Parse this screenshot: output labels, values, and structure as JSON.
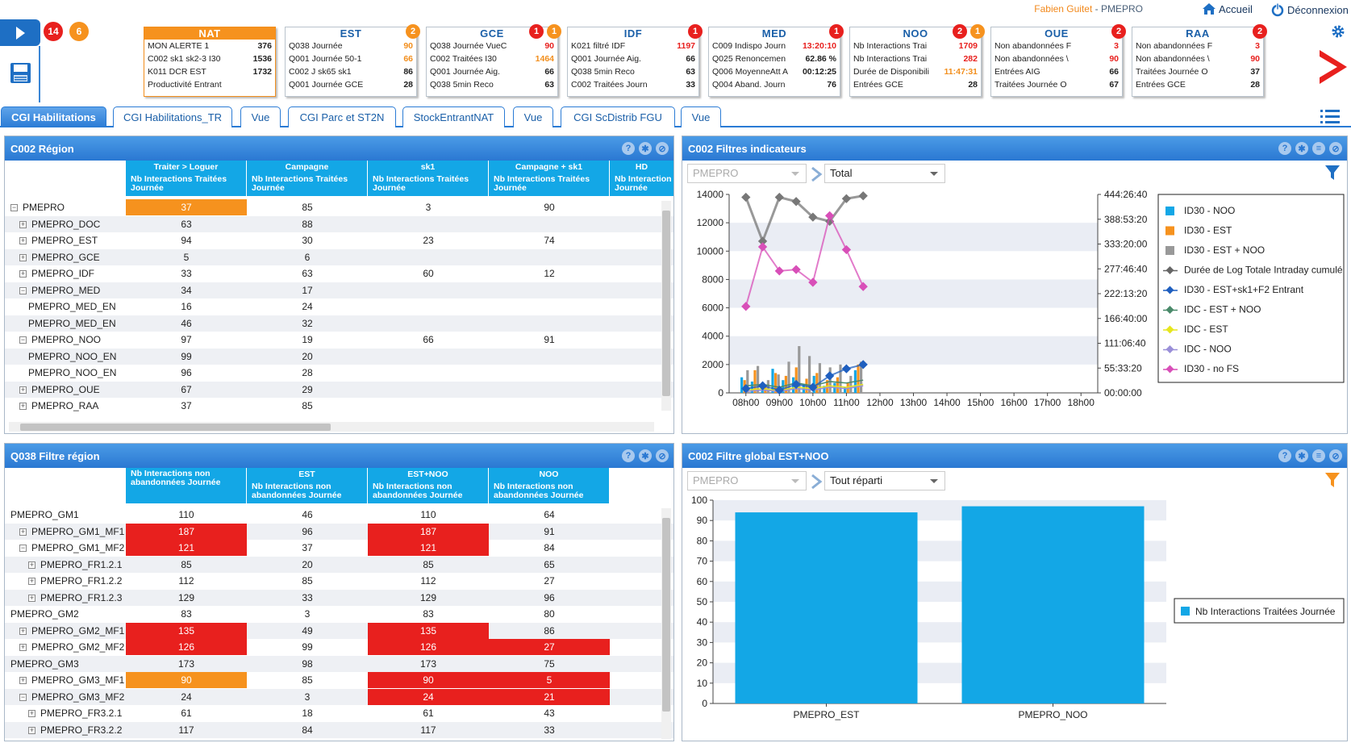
{
  "header": {
    "user_name": "Fabien Guitet",
    "user_sep": " - ",
    "space": "PMEPRO",
    "home_label": "Accueil",
    "logout_label": "Déconnexion"
  },
  "badges": {
    "red_count": "14",
    "orange_count": "6"
  },
  "cards": [
    {
      "title": "NAT",
      "rows": [
        {
          "l": "MON ALERTE 1",
          "v": "376",
          "c": "#222"
        },
        {
          "l": "C002 sk1 sk2-3 I30",
          "v": "1536",
          "c": "#222"
        },
        {
          "l": "K011 DCR EST",
          "v": "1732",
          "c": "#222"
        },
        {
          "l": "Productivité Entrant",
          "v": "",
          "c": "#222"
        }
      ],
      "red": "",
      "orange": ""
    },
    {
      "title": "EST",
      "rows": [
        {
          "l": "Q038 Journée",
          "v": "90",
          "c": "#f28e1c"
        },
        {
          "l": "Q001 Journée 50-1",
          "v": "66",
          "c": "#f28e1c"
        },
        {
          "l": "C002 J sk65 sk1",
          "v": "86",
          "c": "#222"
        },
        {
          "l": "Q001 Journée GCE",
          "v": "28",
          "c": "#222"
        }
      ],
      "red": "",
      "orange": "2"
    },
    {
      "title": "GCE",
      "rows": [
        {
          "l": "Q038 Journée VueC",
          "v": "90",
          "c": "#e8201e"
        },
        {
          "l": "C002 Traitées I30",
          "v": "1464",
          "c": "#f28e1c"
        },
        {
          "l": "Q001 Journée Aig.",
          "v": "66",
          "c": "#222"
        },
        {
          "l": "Q038 5min Reco",
          "v": "63",
          "c": "#222"
        }
      ],
      "red": "1",
      "orange": "1"
    },
    {
      "title": "IDF",
      "rows": [
        {
          "l": "K021 filtré IDF",
          "v": "1197",
          "c": "#e8201e"
        },
        {
          "l": "Q001 Journée Aig.",
          "v": "66",
          "c": "#222"
        },
        {
          "l": "Q038 5min Reco",
          "v": "63",
          "c": "#222"
        },
        {
          "l": "C002 Traitées Journ",
          "v": "33",
          "c": "#222"
        }
      ],
      "red": "1",
      "orange": ""
    },
    {
      "title": "MED",
      "rows": [
        {
          "l": "C009 Indispo Journ",
          "v": "13:20:10",
          "c": "#e8201e"
        },
        {
          "l": "Q025 Renoncemen",
          "v": "62.86 %",
          "c": "#222"
        },
        {
          "l": "Q006 MoyenneAtt A",
          "v": "00:12:25",
          "c": "#222"
        },
        {
          "l": "Q004 Aband. Journ",
          "v": "76",
          "c": "#222"
        }
      ],
      "red": "1",
      "orange": ""
    },
    {
      "title": "NOO",
      "rows": [
        {
          "l": "Nb Interactions Trai",
          "v": "1709",
          "c": "#e8201e"
        },
        {
          "l": "Nb Interactions Trai",
          "v": "282",
          "c": "#e8201e"
        },
        {
          "l": "Durée de Disponibili",
          "v": "11:47:31",
          "c": "#f28e1c"
        },
        {
          "l": "Entrées GCE",
          "v": "28",
          "c": "#222"
        }
      ],
      "red": "2",
      "orange": "1"
    },
    {
      "title": "OUE",
      "rows": [
        {
          "l": "Non abandonnées F",
          "v": "3",
          "c": "#e8201e"
        },
        {
          "l": "Non abandonnées \\",
          "v": "90",
          "c": "#e8201e"
        },
        {
          "l": "Entrées AIG",
          "v": "66",
          "c": "#222"
        },
        {
          "l": "Traitées Journée O",
          "v": "67",
          "c": "#222"
        }
      ],
      "red": "2",
      "orange": ""
    },
    {
      "title": "RAA",
      "rows": [
        {
          "l": "Non abandonnées F",
          "v": "3",
          "c": "#e8201e"
        },
        {
          "l": "Non abandonnées \\",
          "v": "90",
          "c": "#e8201e"
        },
        {
          "l": "Traitées Journée O",
          "v": "37",
          "c": "#222"
        },
        {
          "l": "Entrées GCE",
          "v": "28",
          "c": "#222"
        }
      ],
      "red": "2",
      "orange": ""
    }
  ],
  "tabs": [
    "CGI Habilitations",
    "CGI Habilitations_TR",
    "Vue",
    "CGI Parc et ST2N",
    "StockEntrantNAT",
    "Vue",
    "CGI ScDistrib FGU",
    "Vue"
  ],
  "panel_region": {
    "title": "C002 Région",
    "col_groups": [
      "Traiter > Loguer",
      "Campagne",
      "sk1",
      "Campagne + sk1",
      "HD"
    ],
    "col_sub": [
      "Nb Interactions Traitées Journée",
      "Nb Interactions Traitées Journée",
      "Nb Interactions Traitées Journée",
      "Nb Interactions Traitées Journée",
      "Nb Interaction Journée"
    ],
    "rows": [
      {
        "label": "PMEPRO",
        "lvl": 0,
        "exp": "−",
        "v": [
          "37",
          "85",
          "3",
          "90"
        ],
        "hl": [
          "org",
          "",
          "",
          ""
        ]
      },
      {
        "label": "PMEPRO_DOC",
        "lvl": 1,
        "exp": "+",
        "v": [
          "63",
          "88",
          "",
          ""
        ],
        "hl": [
          "",
          "",
          "",
          ""
        ]
      },
      {
        "label": "PMEPRO_EST",
        "lvl": 1,
        "exp": "+",
        "v": [
          "94",
          "30",
          "23",
          "74"
        ],
        "hl": [
          "",
          "",
          "",
          ""
        ]
      },
      {
        "label": "PMEPRO_GCE",
        "lvl": 1,
        "exp": "+",
        "v": [
          "5",
          "6",
          "",
          ""
        ],
        "hl": [
          "",
          "",
          "",
          ""
        ]
      },
      {
        "label": "PMEPRO_IDF",
        "lvl": 1,
        "exp": "+",
        "v": [
          "33",
          "63",
          "60",
          "12"
        ],
        "hl": [
          "",
          "",
          "",
          ""
        ]
      },
      {
        "label": "PMEPRO_MED",
        "lvl": 1,
        "exp": "−",
        "v": [
          "34",
          "17",
          "",
          ""
        ],
        "hl": [
          "",
          "",
          "",
          ""
        ]
      },
      {
        "label": "PMEPRO_MED_EN",
        "lvl": 2,
        "exp": "",
        "v": [
          "16",
          "24",
          "",
          ""
        ],
        "hl": [
          "",
          "",
          "",
          ""
        ]
      },
      {
        "label": "PMEPRO_MED_EN",
        "lvl": 2,
        "exp": "",
        "v": [
          "46",
          "32",
          "",
          ""
        ],
        "hl": [
          "",
          "",
          "",
          ""
        ]
      },
      {
        "label": "PMEPRO_NOO",
        "lvl": 1,
        "exp": "−",
        "v": [
          "97",
          "19",
          "66",
          "91"
        ],
        "hl": [
          "",
          "",
          "",
          ""
        ]
      },
      {
        "label": "PMEPRO_NOO_EN",
        "lvl": 2,
        "exp": "",
        "v": [
          "99",
          "20",
          "",
          ""
        ],
        "hl": [
          "",
          "",
          "",
          ""
        ]
      },
      {
        "label": "PMEPRO_NOO_EN",
        "lvl": 2,
        "exp": "",
        "v": [
          "96",
          "28",
          "",
          ""
        ],
        "hl": [
          "",
          "",
          "",
          ""
        ]
      },
      {
        "label": "PMEPRO_OUE",
        "lvl": 1,
        "exp": "+",
        "v": [
          "67",
          "29",
          "",
          ""
        ],
        "hl": [
          "",
          "",
          "",
          ""
        ]
      },
      {
        "label": "PMEPRO_RAA",
        "lvl": 1,
        "exp": "+",
        "v": [
          "37",
          "85",
          "",
          ""
        ],
        "hl": [
          "",
          "",
          "",
          ""
        ]
      }
    ]
  },
  "panel_q038": {
    "title": "Q038 Filtre région",
    "col_groups": [
      "Nb Interactions non abandonnées Journée",
      "EST",
      "EST+NOO",
      "NOO"
    ],
    "col_sub": [
      "",
      "Nb Interactions non abandonnées Journée",
      "Nb Interactions non abandonnées Journée",
      "Nb Interactions non abandonnées Journée"
    ],
    "rows": [
      {
        "label": "PMEPRO_GM1",
        "lvl": 0,
        "exp": "",
        "v": [
          "110",
          "46",
          "110",
          "64"
        ],
        "hl": [
          "",
          "",
          "",
          ""
        ]
      },
      {
        "label": "PMEPRO_GM1_MF1",
        "lvl": 1,
        "exp": "+",
        "v": [
          "187",
          "96",
          "187",
          "91"
        ],
        "hl": [
          "red",
          "",
          "red",
          ""
        ]
      },
      {
        "label": "PMEPRO_GM1_MF2",
        "lvl": 1,
        "exp": "−",
        "v": [
          "121",
          "37",
          "121",
          "84"
        ],
        "hl": [
          "red",
          "",
          "red",
          ""
        ]
      },
      {
        "label": "PMEPRO_FR1.2.1",
        "lvl": 2,
        "exp": "+",
        "v": [
          "85",
          "20",
          "85",
          "65"
        ],
        "hl": [
          "",
          "",
          "",
          ""
        ]
      },
      {
        "label": "PMEPRO_FR1.2.2",
        "lvl": 2,
        "exp": "+",
        "v": [
          "112",
          "85",
          "112",
          "27"
        ],
        "hl": [
          "",
          "",
          "",
          ""
        ]
      },
      {
        "label": "PMEPRO_FR1.2.3",
        "lvl": 2,
        "exp": "+",
        "v": [
          "129",
          "33",
          "129",
          "96"
        ],
        "hl": [
          "",
          "",
          "",
          ""
        ]
      },
      {
        "label": "PMEPRO_GM2",
        "lvl": 0,
        "exp": "",
        "v": [
          "83",
          "3",
          "83",
          "80"
        ],
        "hl": [
          "",
          "",
          "",
          ""
        ]
      },
      {
        "label": "PMEPRO_GM2_MF1",
        "lvl": 1,
        "exp": "+",
        "v": [
          "135",
          "49",
          "135",
          "86"
        ],
        "hl": [
          "red",
          "",
          "red",
          ""
        ]
      },
      {
        "label": "PMEPRO_GM2_MF2",
        "lvl": 1,
        "exp": "+",
        "v": [
          "126",
          "99",
          "126",
          "27"
        ],
        "hl": [
          "red",
          "",
          "red",
          "red"
        ]
      },
      {
        "label": "PMEPRO_GM3",
        "lvl": 0,
        "exp": "",
        "v": [
          "173",
          "98",
          "173",
          "75"
        ],
        "hl": [
          "",
          "",
          "",
          ""
        ]
      },
      {
        "label": "PMEPRO_GM3_MF1",
        "lvl": 1,
        "exp": "+",
        "v": [
          "90",
          "85",
          "90",
          "5"
        ],
        "hl": [
          "org",
          "",
          "red",
          "red"
        ]
      },
      {
        "label": "PMEPRO_GM3_MF2",
        "lvl": 1,
        "exp": "−",
        "v": [
          "24",
          "3",
          "24",
          "21"
        ],
        "hl": [
          "",
          "",
          "red",
          "red"
        ]
      },
      {
        "label": "PMEPRO_FR3.2.1",
        "lvl": 2,
        "exp": "+",
        "v": [
          "61",
          "18",
          "61",
          "43"
        ],
        "hl": [
          "",
          "",
          "",
          ""
        ]
      },
      {
        "label": "PMEPRO_FR3.2.2",
        "lvl": 2,
        "exp": "+",
        "v": [
          "117",
          "84",
          "117",
          "33"
        ],
        "hl": [
          "",
          "",
          "",
          ""
        ]
      }
    ]
  },
  "panel_filters": {
    "title": "C002 Filtres indicateurs",
    "select1": "PMEPRO",
    "select2": "Total"
  },
  "panel_global": {
    "title": "C002 Filtre global EST+NOO",
    "select1": "PMEPRO",
    "select2": "Tout réparti"
  },
  "chart_data": [
    {
      "type": "line",
      "x": [
        "08h00",
        "09h00",
        "10h00",
        "11h00",
        "12h00",
        "13h00",
        "14h00",
        "15h00",
        "16h00",
        "17h00",
        "18h00"
      ],
      "ylim": [
        0,
        14000
      ],
      "yticks": [
        "0",
        "2000",
        "4000",
        "6000",
        "8000",
        "10000",
        "12000",
        "14000"
      ],
      "y2ticks": [
        "00:00:00",
        "55:33:20",
        "111:06:40",
        "166:40:00",
        "222:13:20",
        "277:46:40",
        "333:20:00",
        "388:53:20",
        "444:26:40"
      ],
      "legend": [
        "ID30 - NOO",
        "ID30 - EST",
        "ID30 - EST + NOO",
        "Durée de Log Totale Intraday cumulé",
        "ID30 - EST+sk1+F2 Entrant",
        "IDC - EST + NOO",
        "IDC - EST",
        "IDC - NOO",
        "ID30 - no FS"
      ],
      "legend_colors": [
        "#13a7e6",
        "#f6921e",
        "#999999",
        "#666666",
        "#1f5fbf",
        "#4a8a6a",
        "#e6e61e",
        "#9a8fd8",
        "#d84fb8"
      ],
      "legend_position": "right",
      "series": [
        {
          "name": "Durée de Log Totale Intraday cumulé",
          "x": [
            0.5,
            1,
            1.5,
            2,
            2.5,
            3,
            3.5,
            4
          ],
          "values": [
            13800,
            10700,
            13800,
            13500,
            12400,
            12100,
            13700,
            13900
          ]
        },
        {
          "name": "ID30 - no FS",
          "x": [
            0.5,
            1,
            1.5,
            2,
            2.5,
            3,
            3.5,
            4
          ],
          "values": [
            6100,
            10300,
            8600,
            8700,
            7800,
            12500,
            10100,
            7500
          ]
        },
        {
          "name": "ID30 - EST+sk1+F2 Entrant",
          "x": [
            0.5,
            1,
            1.5,
            2,
            2.5,
            3,
            3.5,
            4
          ],
          "values": [
            300,
            500,
            200,
            600,
            400,
            1200,
            1700,
            2000
          ]
        }
      ]
    },
    {
      "type": "bar",
      "categories": [
        "PMEPRO_EST",
        "PMEPRO_NOO"
      ],
      "values": [
        94,
        97
      ],
      "ylim": [
        0,
        100
      ],
      "yticks": [
        "0",
        "10",
        "20",
        "30",
        "40",
        "50",
        "60",
        "70",
        "80",
        "90",
        "100"
      ],
      "legend": [
        "Nb Interactions Traitées Journée"
      ],
      "color": "#13a7e6"
    }
  ]
}
